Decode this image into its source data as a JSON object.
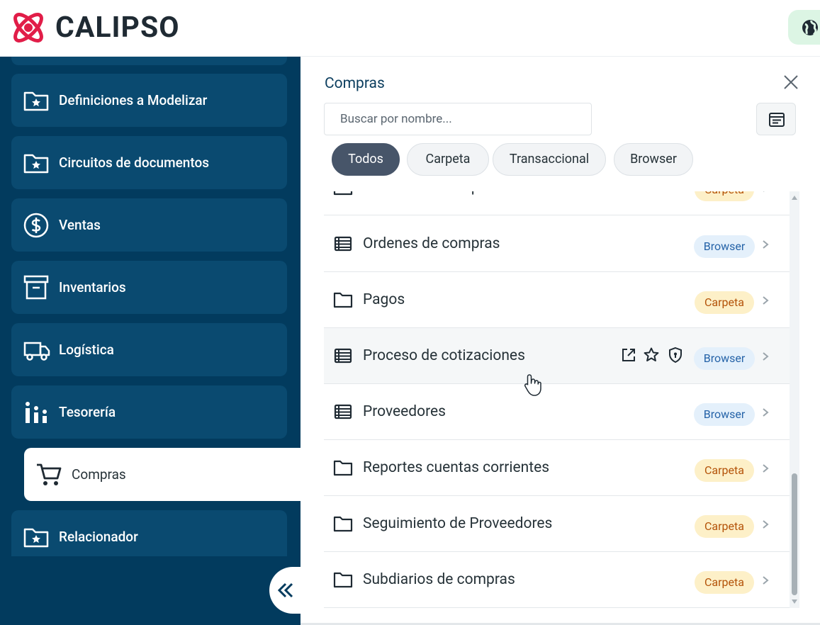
{
  "header": {
    "brand": "CALIPSO",
    "accent_color": "#e11d48",
    "globe_icon": "globe-icon"
  },
  "sidebar": {
    "items": [
      {
        "label": "Definiciones a Modelizar",
        "icon": "folder-star-icon"
      },
      {
        "label": "Circuitos de documentos",
        "icon": "folder-star-icon"
      },
      {
        "label": "Ventas",
        "icon": "dollar-circle-icon"
      },
      {
        "label": "Inventarios",
        "icon": "archive-box-icon"
      },
      {
        "label": "Logística",
        "icon": "truck-icon"
      },
      {
        "label": "Tesorería",
        "icon": "bars-chart-icon"
      },
      {
        "label": "Compras",
        "icon": "shopping-cart-icon",
        "active": true
      },
      {
        "label": "Relacionador",
        "icon": "folder-star-icon"
      }
    ],
    "collapse_icon": "double-chevron-left-icon"
  },
  "panel": {
    "title": "Compras",
    "search_placeholder": "Buscar por nombre...",
    "filters": [
      "Todos",
      "Carpeta",
      "Transaccional",
      "Browser"
    ],
    "active_filter": "Todos",
    "rows": [
      {
        "name": "Ordenes de compras",
        "type": "Carpeta",
        "icon": "folder-icon"
      },
      {
        "name": "Ordenes de compras",
        "type": "Browser",
        "icon": "list-icon"
      },
      {
        "name": "Pagos",
        "type": "Carpeta",
        "icon": "folder-icon"
      },
      {
        "name": "Proceso de cotizaciones",
        "type": "Browser",
        "icon": "list-icon",
        "hover": true
      },
      {
        "name": "Proveedores",
        "type": "Browser",
        "icon": "list-icon"
      },
      {
        "name": "Reportes cuentas corrientes",
        "type": "Carpeta",
        "icon": "folder-icon"
      },
      {
        "name": "Seguimiento de Proveedores",
        "type": "Carpeta",
        "icon": "folder-icon"
      },
      {
        "name": "Subdiarios de compras",
        "type": "Carpeta",
        "icon": "folder-icon"
      }
    ],
    "colors": {
      "sidebar_bg": "#023b5e",
      "browser_badge_bg": "#e4f0fb",
      "browser_badge_text": "#2563a8",
      "carpeta_badge_bg": "#fdf0c8",
      "carpeta_badge_text": "#b45309",
      "active_chip_bg": "#475569"
    }
  }
}
